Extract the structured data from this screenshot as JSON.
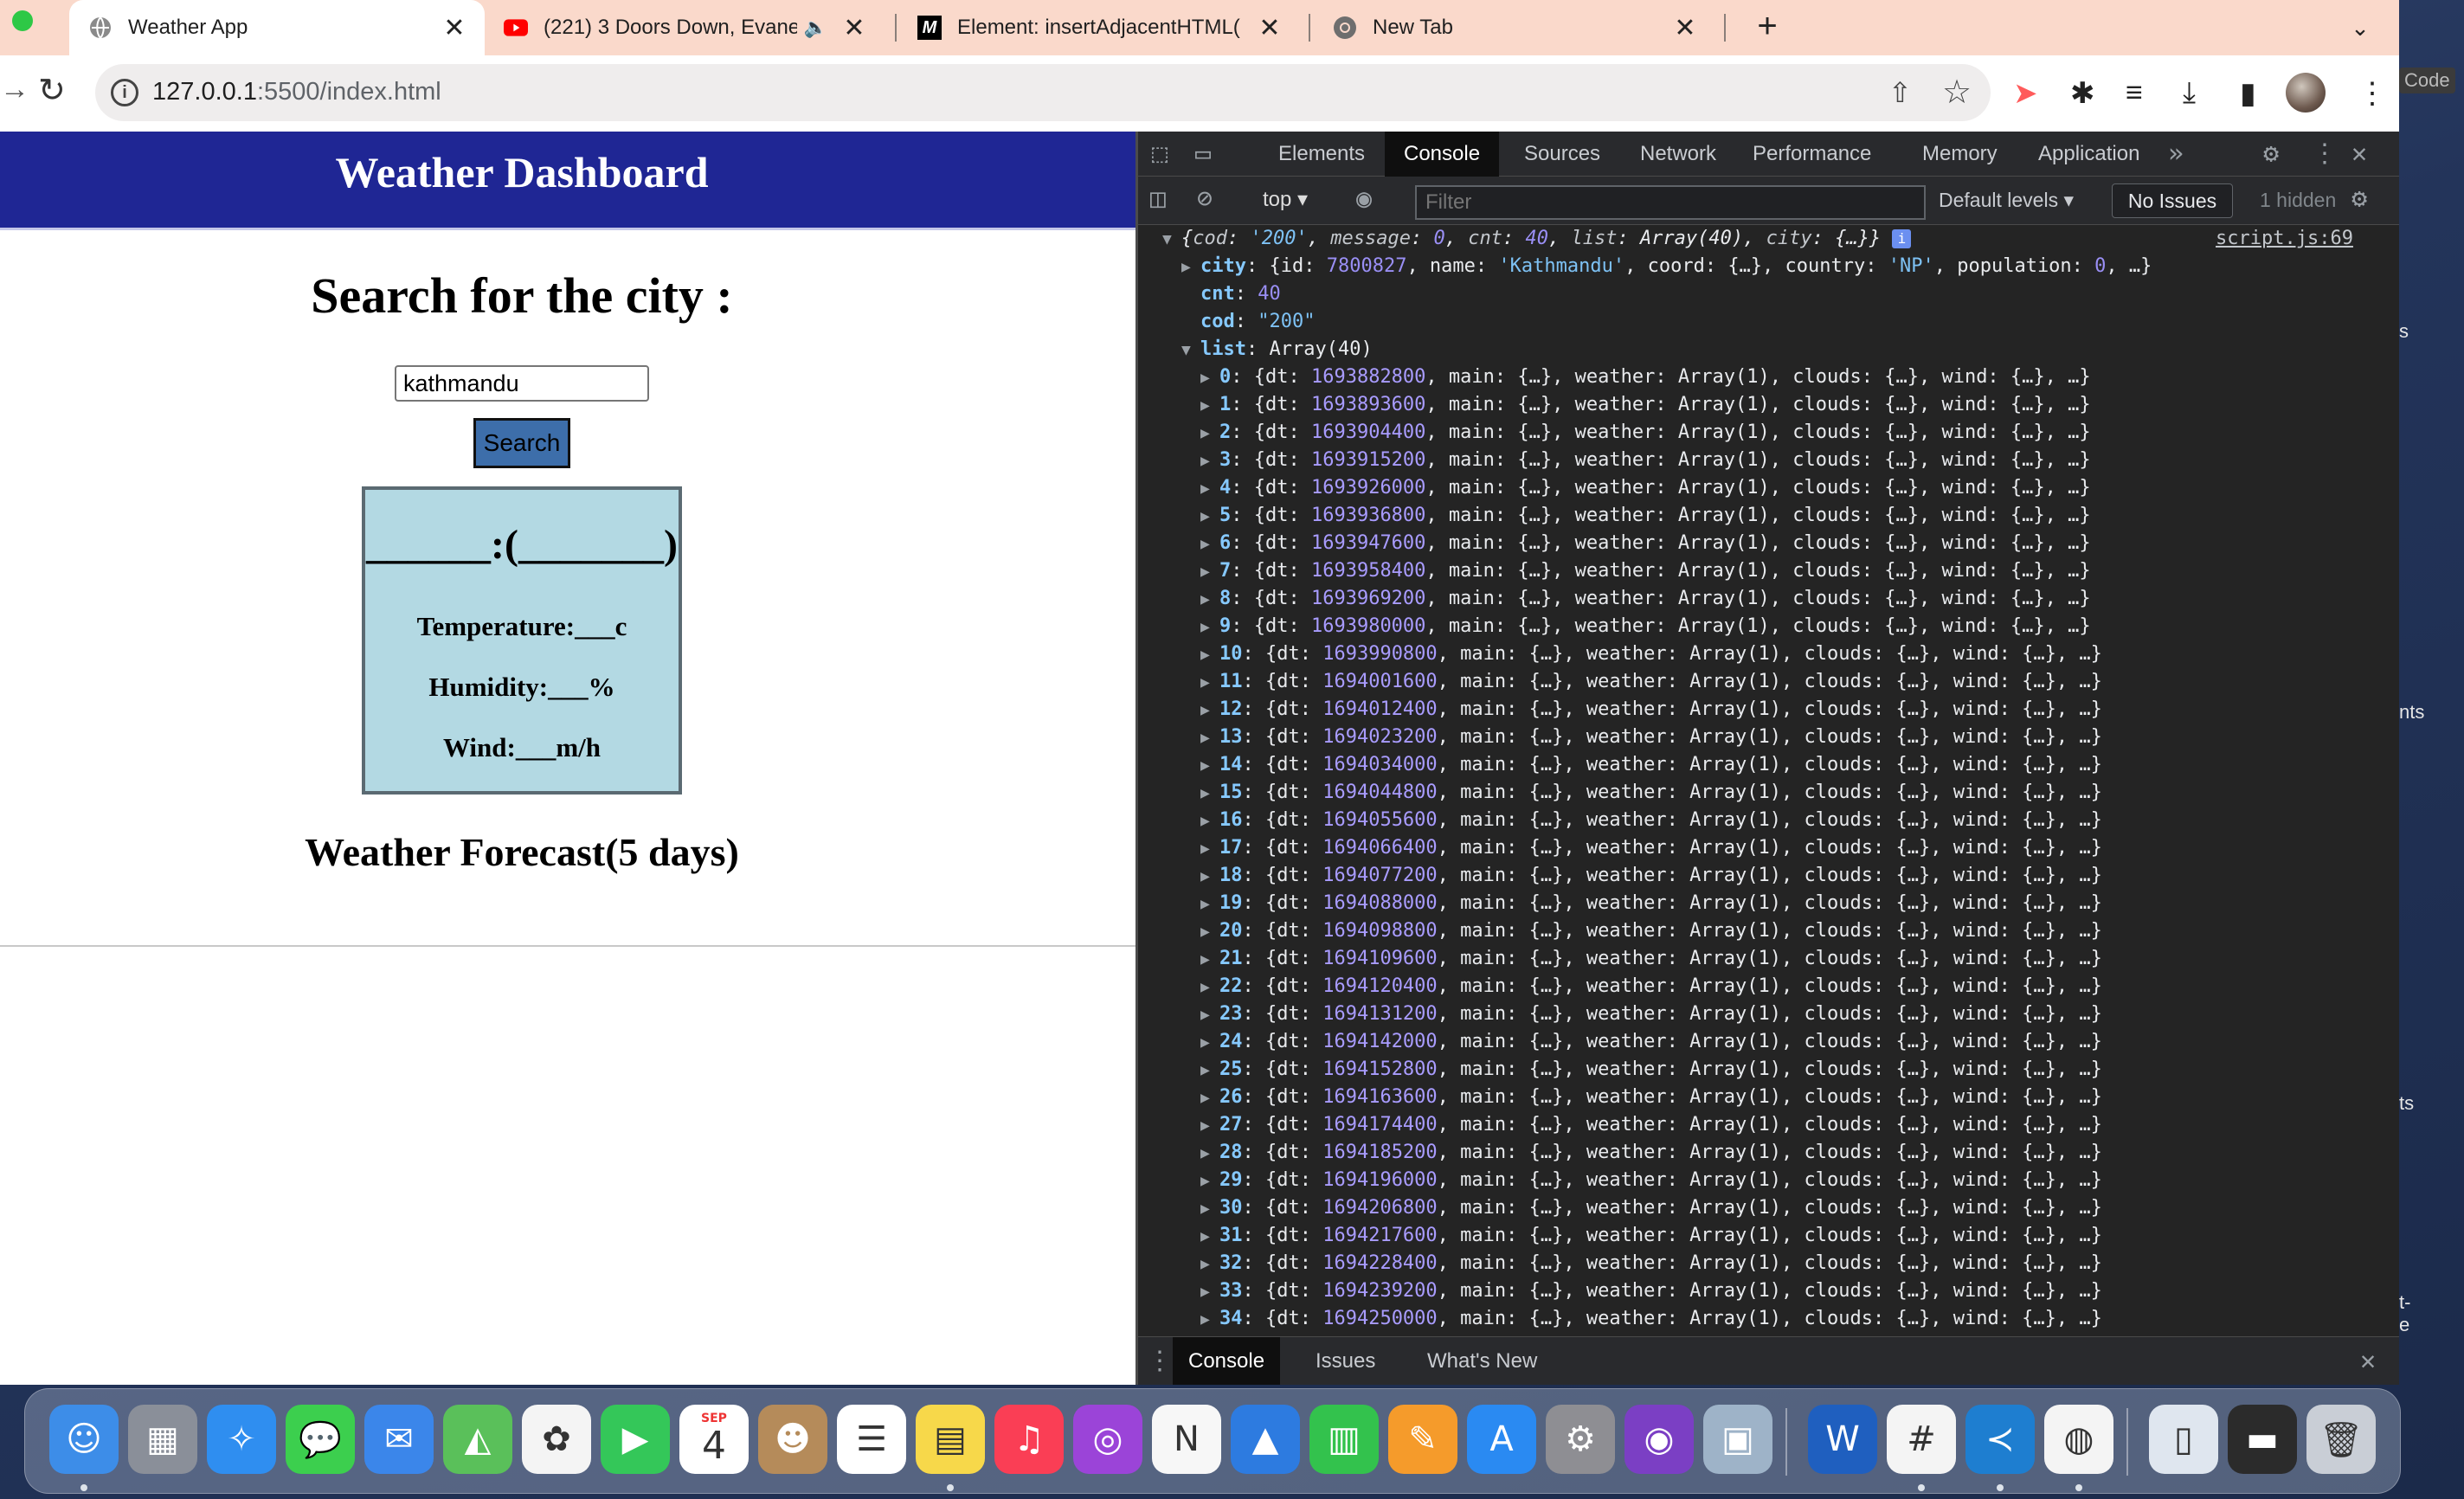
{
  "desktop": {
    "side_text": [
      "Code",
      "s",
      "nts",
      "ts",
      "t-",
      "e"
    ]
  },
  "browser": {
    "tabs": [
      {
        "title": "Weather App",
        "icon": "globe-icon",
        "close": "✕",
        "active": true
      },
      {
        "title": "(221) 3 Doors Down, Evane",
        "icon": "youtube-icon",
        "close": "✕",
        "active": false
      },
      {
        "title": "Element: insertAdjacentHTML(",
        "icon": "mdn-icon",
        "close": "✕",
        "active": false
      },
      {
        "title": "New Tab",
        "icon": "chrome-icon",
        "close": "✕",
        "active": false
      }
    ],
    "new_tab": "+",
    "url_host": "127.0.0.1",
    "url_rest": ":5500/index.html"
  },
  "page": {
    "header_title": "Weather Dashboard",
    "search_heading": "Search for the city :",
    "city_input_value": "kathmandu",
    "search_button": "Search",
    "card_city": "______:(_______)",
    "temperature": "Temperature:___c",
    "humidity": "Humidity:___%",
    "wind": "Wind:___m/h",
    "forecast_heading": "Weather Forecast(5 days)"
  },
  "devtools": {
    "tabs": [
      "Elements",
      "Console",
      "Sources",
      "Network",
      "Performance",
      "Memory",
      "Application"
    ],
    "active_tab": "Console",
    "context": "top",
    "filter_placeholder": "Filter",
    "levels": "Default levels ▾",
    "issues": "No Issues",
    "hidden": "1 hidden",
    "source_link": "script.js:69",
    "root_line": {
      "pre": "{",
      "k1": "cod",
      "v1": "'200'",
      "k2": "message",
      "v2": "0",
      "k3": "cnt",
      "v3": "40",
      "k4": "list",
      "v4": "Array(40)",
      "k5": "city",
      "v5": "{…}",
      "post": "}"
    },
    "city_line": {
      "k": "city",
      "pre": "{id: ",
      "id": "7800827",
      "mid1": ", name: ",
      "name": "'Kathmandu'",
      "mid2": ", coord: {…}, country: ",
      "country": "'NP'",
      "mid3": ", population: ",
      "pop": "0",
      "post": ", …}"
    },
    "cnt_line": {
      "k": "cnt",
      "v": "40"
    },
    "cod_line": {
      "k": "cod",
      "v": "\"200\""
    },
    "list_line": {
      "k": "list",
      "v": "Array(40)"
    },
    "list_items": [
      {
        "i": "0",
        "dt": "1693882800"
      },
      {
        "i": "1",
        "dt": "1693893600"
      },
      {
        "i": "2",
        "dt": "1693904400"
      },
      {
        "i": "3",
        "dt": "1693915200"
      },
      {
        "i": "4",
        "dt": "1693926000"
      },
      {
        "i": "5",
        "dt": "1693936800"
      },
      {
        "i": "6",
        "dt": "1693947600"
      },
      {
        "i": "7",
        "dt": "1693958400"
      },
      {
        "i": "8",
        "dt": "1693969200"
      },
      {
        "i": "9",
        "dt": "1693980000"
      },
      {
        "i": "10",
        "dt": "1693990800"
      },
      {
        "i": "11",
        "dt": "1694001600"
      },
      {
        "i": "12",
        "dt": "1694012400"
      },
      {
        "i": "13",
        "dt": "1694023200"
      },
      {
        "i": "14",
        "dt": "1694034000"
      },
      {
        "i": "15",
        "dt": "1694044800"
      },
      {
        "i": "16",
        "dt": "1694055600"
      },
      {
        "i": "17",
        "dt": "1694066400"
      },
      {
        "i": "18",
        "dt": "1694077200"
      },
      {
        "i": "19",
        "dt": "1694088000"
      },
      {
        "i": "20",
        "dt": "1694098800"
      },
      {
        "i": "21",
        "dt": "1694109600"
      },
      {
        "i": "22",
        "dt": "1694120400"
      },
      {
        "i": "23",
        "dt": "1694131200"
      },
      {
        "i": "24",
        "dt": "1694142000"
      },
      {
        "i": "25",
        "dt": "1694152800"
      },
      {
        "i": "26",
        "dt": "1694163600"
      },
      {
        "i": "27",
        "dt": "1694174400"
      },
      {
        "i": "28",
        "dt": "1694185200"
      },
      {
        "i": "29",
        "dt": "1694196000"
      },
      {
        "i": "30",
        "dt": "1694206800"
      },
      {
        "i": "31",
        "dt": "1694217600"
      },
      {
        "i": "32",
        "dt": "1694228400"
      },
      {
        "i": "33",
        "dt": "1694239200"
      },
      {
        "i": "34",
        "dt": "1694250000"
      }
    ],
    "item_rest": ", main: {…}, weather: Array(1), clouds: {…}, wind: {…}, …}",
    "drawer_tabs": [
      "Console",
      "Issues",
      "What's New"
    ]
  },
  "dock": {
    "calendar_month": "SEP",
    "calendar_day": "4",
    "apps": [
      {
        "name": "finder-icon",
        "color": "#3d8de8"
      },
      {
        "name": "launchpad-icon",
        "color": "#8a8f99"
      },
      {
        "name": "safari-icon",
        "color": "#2f8ef0"
      },
      {
        "name": "messages-icon",
        "color": "#3ccf4e"
      },
      {
        "name": "mail-icon",
        "color": "#3b86ea"
      },
      {
        "name": "maps-icon",
        "color": "#5ac05a"
      },
      {
        "name": "photos-icon",
        "color": "#f4f4f4"
      },
      {
        "name": "facetime-icon",
        "color": "#34c759"
      },
      {
        "name": "calendar-icon",
        "color": "#ffffff"
      },
      {
        "name": "contacts-icon",
        "color": "#b58b5a"
      },
      {
        "name": "reminders-icon",
        "color": "#ffffff"
      },
      {
        "name": "notes-icon",
        "color": "#f7d84a"
      },
      {
        "name": "music-icon",
        "color": "#fa3e55"
      },
      {
        "name": "podcasts-icon",
        "color": "#9b44d8"
      },
      {
        "name": "news-icon",
        "color": "#f7f7f7"
      },
      {
        "name": "keynote-icon",
        "color": "#2d7be0"
      },
      {
        "name": "numbers-icon",
        "color": "#33c24d"
      },
      {
        "name": "pages-icon",
        "color": "#f59b2b"
      },
      {
        "name": "app-store-icon",
        "color": "#2a8af2"
      },
      {
        "name": "system-settings-icon",
        "color": "#8e8e93"
      },
      {
        "name": "github-desktop-icon",
        "color": "#7b3fc4"
      },
      {
        "name": "preview-icon",
        "color": "#9eb3c8"
      },
      {
        "name": "word-icon",
        "color": "#1f5fbf"
      },
      {
        "name": "slack-icon",
        "color": "#f4f4f4"
      },
      {
        "name": "vscode-icon",
        "color": "#1e7ed0"
      },
      {
        "name": "chrome-icon",
        "color": "#f4f4f4"
      },
      {
        "name": "downloads-folder-icon",
        "color": "#dfe6ef"
      },
      {
        "name": "screenshot-stack-icon",
        "color": "#2b2b2b"
      },
      {
        "name": "trash-icon",
        "color": "#c9ced6"
      }
    ]
  }
}
